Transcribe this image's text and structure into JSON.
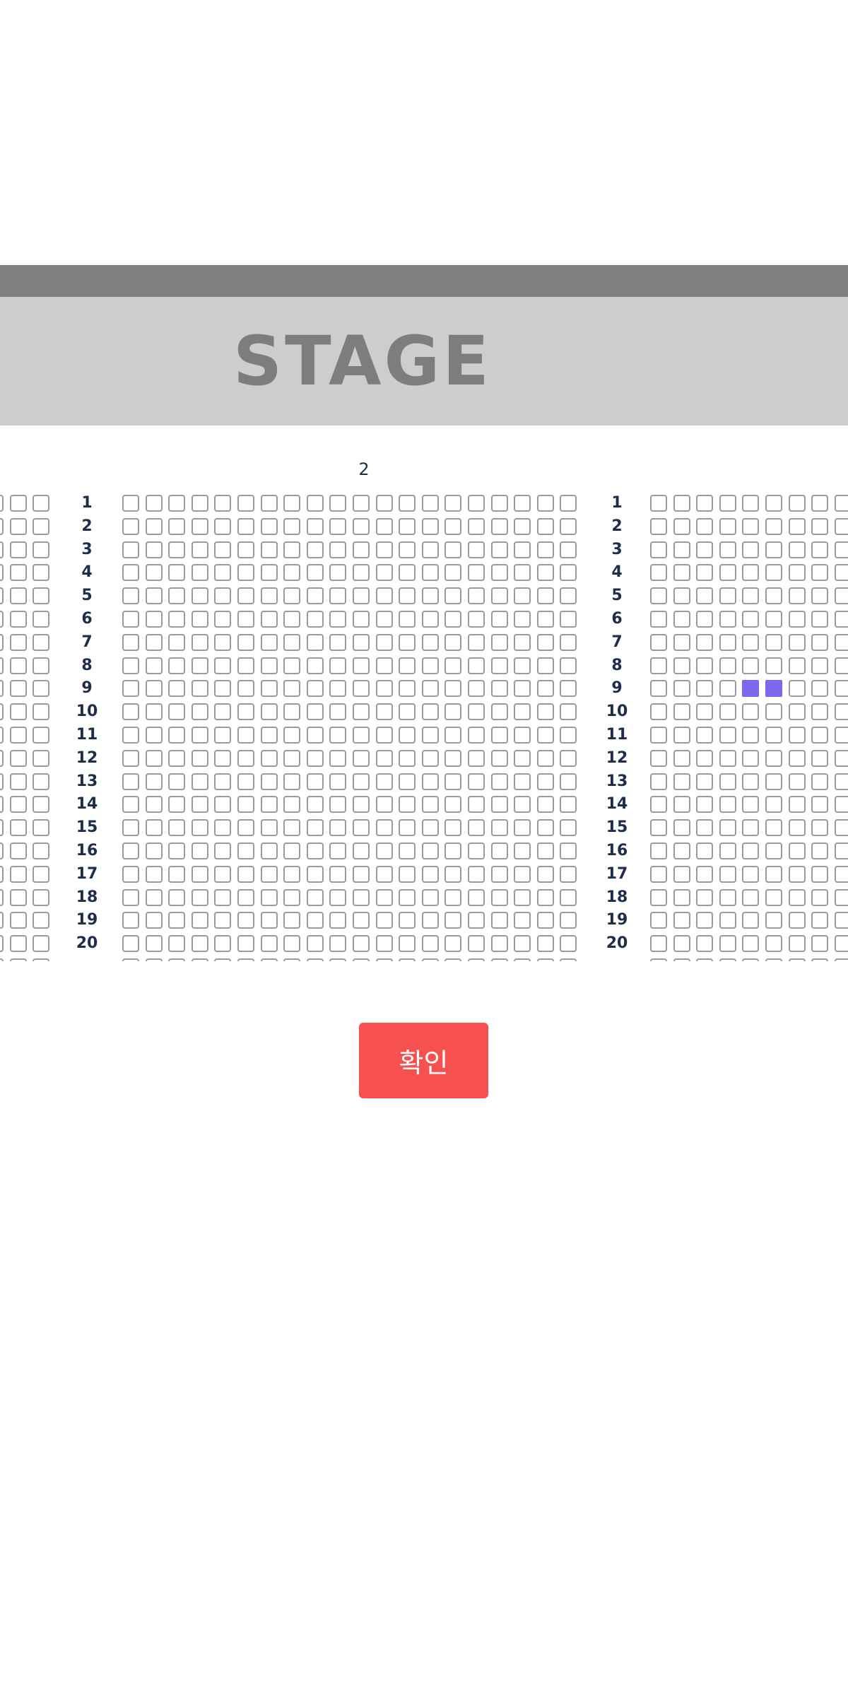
{
  "stage": {
    "label": "STAGE"
  },
  "seat_map": {
    "section_label": "2",
    "row_labels": [
      "1",
      "2",
      "3",
      "4",
      "5",
      "6",
      "7",
      "8",
      "9",
      "10",
      "11",
      "12",
      "13",
      "14",
      "15",
      "16",
      "17",
      "18",
      "19",
      "20"
    ],
    "seat_colors": {
      "available_border": "#9a9a9a",
      "selected": "#7b68ee"
    },
    "blocks": [
      {
        "name": "left",
        "seats_per_row": 3
      },
      {
        "name": "center",
        "seats_per_row": 20
      },
      {
        "name": "right",
        "seats_per_row": 9
      }
    ],
    "selected_seats": [
      {
        "block": "right",
        "row": "9",
        "seat": 5
      },
      {
        "block": "right",
        "row": "9",
        "seat": 6
      }
    ]
  },
  "confirm_label": "확인",
  "colors": {
    "stage_bar": "#808080",
    "stage_background": "#cdcdcd",
    "stage_text": "#7d7d7d",
    "row_label": "#1e2d4a",
    "confirm_button": "#f6504f"
  }
}
